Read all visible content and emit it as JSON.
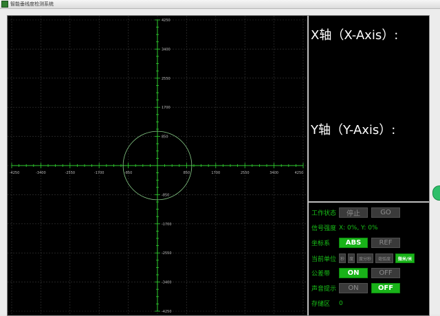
{
  "window": {
    "title": "智能垂线度检测系统"
  },
  "plot": {
    "x_ticks": [
      "-4250",
      "-3400",
      "-2550",
      "-1700",
      "-850",
      "850",
      "1700",
      "2550",
      "3400",
      "4250"
    ],
    "y_ticks": [
      "4250",
      "3400",
      "2550",
      "1700",
      "850",
      "-850",
      "-1700",
      "-2550",
      "-3400",
      "-4250"
    ],
    "tolerance_circle_radius": 1000,
    "range": [
      -4250,
      4250
    ]
  },
  "readout": {
    "x_label": "X轴（X-Axis）:",
    "y_label": "Y轴（Y-Axis）:"
  },
  "controls": {
    "status": {
      "label": "工作状态",
      "stop": "停止",
      "go": "GO"
    },
    "signal": {
      "label": "信号强度",
      "value": "X: 0%, Y: 0%"
    },
    "coord": {
      "label": "坐标系",
      "abs": "ABS",
      "ref": "REF",
      "selected": "ABS"
    },
    "unit": {
      "label": "当前单位",
      "options": [
        "秒",
        "度",
        "度分秒",
        "毫弧度",
        "微米/米"
      ],
      "selected": "微米/米"
    },
    "tolerance": {
      "label": "公差带",
      "on": "ON",
      "off": "OFF",
      "selected": "ON"
    },
    "sound": {
      "label": "声音提示",
      "on": "ON",
      "off": "OFF",
      "selected": "OFF"
    },
    "storage": {
      "label": "存储区",
      "value": "0"
    }
  },
  "colors": {
    "axis_green": "#30d030",
    "grid": "#3a3a3a",
    "accent": "#19b319"
  }
}
